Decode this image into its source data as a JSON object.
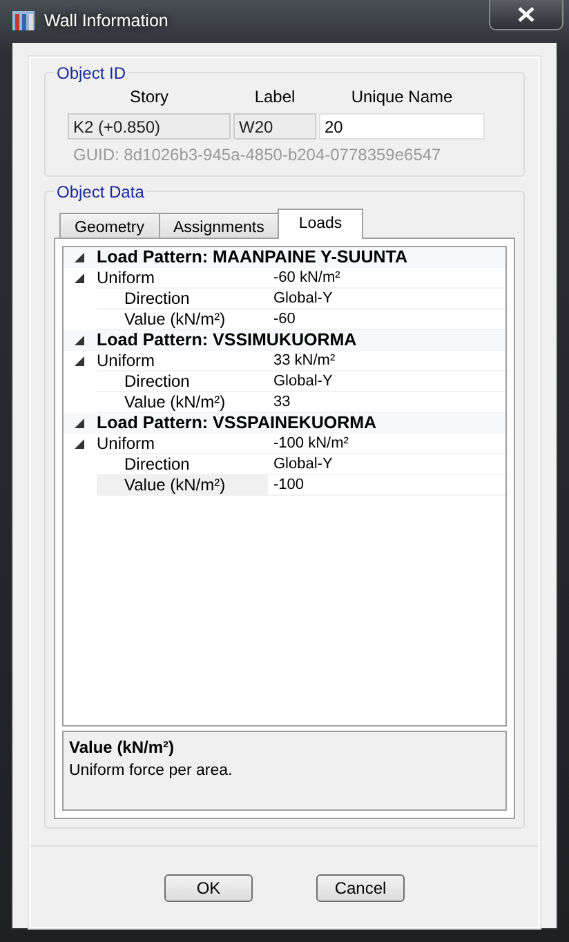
{
  "window": {
    "title": "Wall Information"
  },
  "object_id": {
    "title": "Object ID",
    "fields": [
      {
        "label": "Story",
        "value": "K2 (+0.850)",
        "readonly": true
      },
      {
        "label": "Label",
        "value": "W20",
        "readonly": true
      },
      {
        "label": "Unique Name",
        "value": "20",
        "readonly": false
      }
    ],
    "guid": "GUID:  8d1026b3-945a-4850-b204-0778359e6547"
  },
  "object_data": {
    "title": "Object Data",
    "tabs": [
      {
        "label": "Geometry",
        "selected": false
      },
      {
        "label": "Assignments",
        "selected": false
      },
      {
        "label": "Loads",
        "selected": true
      }
    ],
    "patterns": [
      {
        "title": "Load Pattern: MAANPAINE Y-SUUNTA",
        "expanded": true,
        "children": [
          {
            "name": "Uniform",
            "value": "-60 kN/m²",
            "expanded": true,
            "children": [
              {
                "name": "Direction",
                "value": "Global-Y",
                "selected": false
              },
              {
                "name": "Value (kN/m²)",
                "value": "-60",
                "selected": false
              }
            ]
          }
        ]
      },
      {
        "title": "Load Pattern: VSSIMUKUORMA",
        "expanded": true,
        "children": [
          {
            "name": "Uniform",
            "value": "33 kN/m²",
            "expanded": true,
            "children": [
              {
                "name": "Direction",
                "value": "Global-Y",
                "selected": false
              },
              {
                "name": "Value (kN/m²)",
                "value": "33",
                "selected": false
              }
            ]
          }
        ]
      },
      {
        "title": "Load Pattern: VSSPAINEKUORMA",
        "expanded": true,
        "children": [
          {
            "name": "Uniform",
            "value": "-100 kN/m²",
            "expanded": true,
            "children": [
              {
                "name": "Direction",
                "value": "Global-Y",
                "selected": false
              },
              {
                "name": "Value (kN/m²)",
                "value": "-100",
                "selected": true
              }
            ]
          }
        ]
      }
    ],
    "description": {
      "title": "Value (kN/m²)",
      "text": "Uniform force per area."
    }
  },
  "buttons": [
    "OK",
    "Cancel"
  ]
}
